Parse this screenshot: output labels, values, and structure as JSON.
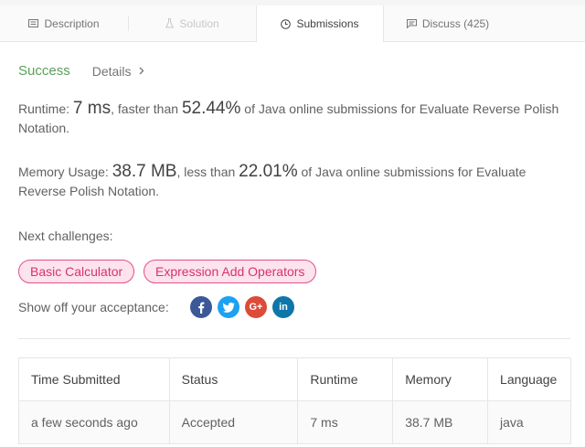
{
  "tabs": [
    {
      "label": "Description",
      "icon": "document-icon",
      "state": "normal"
    },
    {
      "label": "Solution",
      "icon": "flask-icon",
      "state": "disabled"
    },
    {
      "label": "Submissions",
      "icon": "clock-icon",
      "state": "active"
    },
    {
      "label": "Discuss (425)",
      "icon": "comment-icon",
      "state": "normal"
    }
  ],
  "result": {
    "status": "Success",
    "details_label": "Details"
  },
  "runtime": {
    "label": "Runtime: ",
    "value": "7 ms",
    "comparison": ", faster than ",
    "percent": "52.44%",
    "suffix": " of Java online submissions for Evaluate Reverse Polish Notation."
  },
  "memory": {
    "label": "Memory Usage: ",
    "value": "38.7 MB",
    "comparison": ", less than ",
    "percent": "22.01%",
    "suffix": " of Java online submissions for Evaluate Reverse Polish Notation."
  },
  "next_challenges": {
    "label": "Next challenges:",
    "items": [
      "Basic Calculator",
      "Expression Add Operators"
    ]
  },
  "share": {
    "label": "Show off your acceptance:",
    "networks": [
      "facebook-icon",
      "twitter-icon",
      "google-plus-icon",
      "linkedin-icon"
    ]
  },
  "table": {
    "headers": [
      "Time Submitted",
      "Status",
      "Runtime",
      "Memory",
      "Language"
    ],
    "rows": [
      [
        "a few seconds ago",
        "Accepted",
        "7 ms",
        "38.7 MB",
        "java"
      ]
    ]
  },
  "colors": {
    "success": "#5aa05a",
    "pill_border": "#e0508a",
    "pill_bg": "#fde3ee",
    "pill_text": "#d6336c"
  }
}
